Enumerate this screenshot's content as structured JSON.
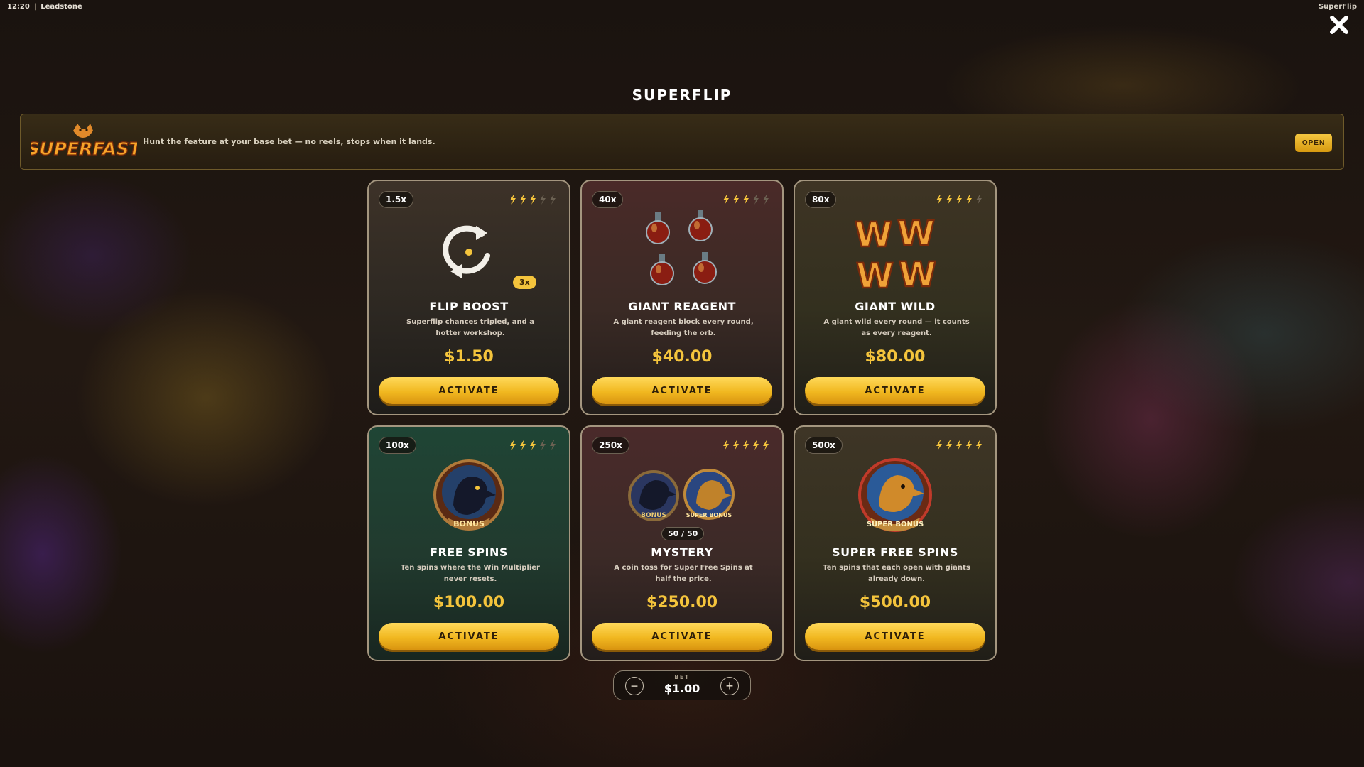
{
  "status_bar": {
    "time": "12:20",
    "separator": "|",
    "user": "Leadstone"
  },
  "app_name": "SuperFlip",
  "header": {
    "title": "SUPERFLIP",
    "close_icon": "close-icon"
  },
  "banner": {
    "logo_text": "SUPERFAST",
    "text": "Hunt the feature at your base bet — no reels, stops when it lands.",
    "open_label": "OPEN"
  },
  "colors": {
    "accent": "#f4c43c",
    "button_text": "#2e1f08"
  },
  "cards": [
    {
      "multiplier": "1.5x",
      "rating": 3,
      "name": "FLIP BOOST",
      "description": "Superflip chances tripled, and a hotter workshop.",
      "price": "$1.50",
      "chip": "3x",
      "action": "ACTIVATE",
      "icon": "refresh-cycle-icon"
    },
    {
      "multiplier": "40x",
      "rating": 3,
      "name": "GIANT REAGENT",
      "description": "A giant reagent block every round, feeding the orb.",
      "price": "$40.00",
      "action": "ACTIVATE",
      "icon": "potion-bottles-icon"
    },
    {
      "multiplier": "80x",
      "rating": 4,
      "name": "GIANT WILD",
      "description": "A giant wild every round — it counts as every reagent.",
      "price": "$80.00",
      "art_letter": "W",
      "action": "ACTIVATE",
      "icon": "wild-symbols-icon"
    },
    {
      "multiplier": "100x",
      "rating": 3,
      "name": "FREE SPINS",
      "description": "Ten spins where the Win Multiplier never resets.",
      "price": "$100.00",
      "art_label": "BONUS",
      "action": "ACTIVATE",
      "icon": "raven-bonus-icon"
    },
    {
      "multiplier": "250x",
      "rating": 5,
      "name": "MYSTERY",
      "description": "A coin toss for Super Free Spins at half the price.",
      "price": "$250.00",
      "chip": "50 / 50",
      "art_label_a": "BONUS",
      "art_label_b": "SUPER BONUS",
      "action": "ACTIVATE",
      "icon": "coin-toss-icon"
    },
    {
      "multiplier": "500x",
      "rating": 5,
      "name": "SUPER FREE SPINS",
      "description": "Ten spins that each open with giants already down.",
      "price": "$500.00",
      "art_label": "SUPER BONUS",
      "action": "ACTIVATE",
      "icon": "eagle-super-bonus-icon"
    }
  ],
  "rating_max": 5,
  "bet": {
    "label": "BET",
    "value": "$1.00",
    "minus": "−",
    "plus": "+"
  }
}
